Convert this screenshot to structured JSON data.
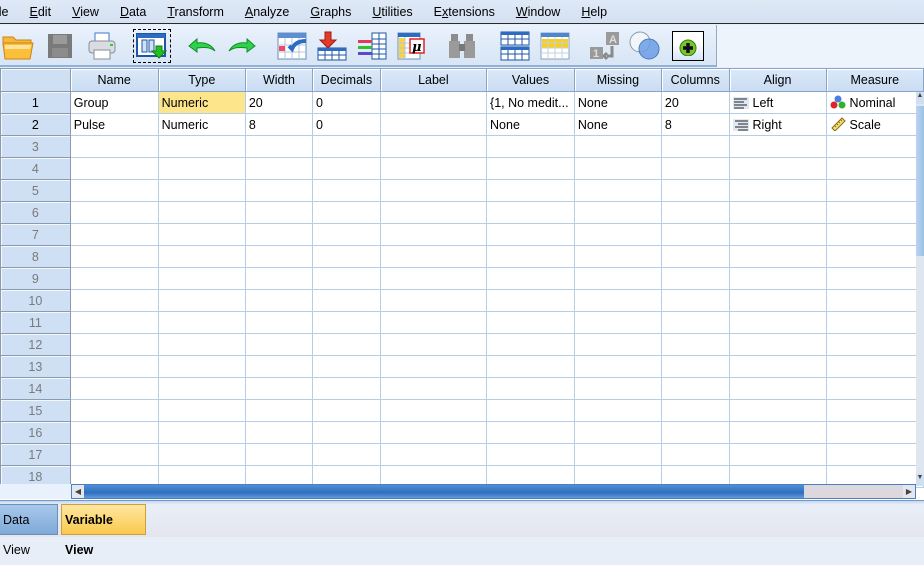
{
  "menubar": {
    "items": [
      {
        "label": "ile",
        "mnemonic": ""
      },
      {
        "label": "Edit",
        "mnemonic": "E"
      },
      {
        "label": "View",
        "mnemonic": "V"
      },
      {
        "label": "Data",
        "mnemonic": "D"
      },
      {
        "label": "Transform",
        "mnemonic": "T"
      },
      {
        "label": "Analyze",
        "mnemonic": "A"
      },
      {
        "label": "Graphs",
        "mnemonic": "G"
      },
      {
        "label": "Utilities",
        "mnemonic": "U"
      },
      {
        "label": "Extensions",
        "mnemonic": "x"
      },
      {
        "label": "Window",
        "mnemonic": "W"
      },
      {
        "label": "Help",
        "mnemonic": "H"
      }
    ]
  },
  "toolbar": {
    "buttons": [
      {
        "name": "open-folder-icon"
      },
      {
        "name": "save-icon",
        "disabled": true
      },
      {
        "name": "print-icon"
      },
      {
        "name": "recall-dialog-icon",
        "focused": true
      },
      {
        "name": "undo-icon"
      },
      {
        "name": "redo-icon"
      },
      {
        "name": "goto-case-icon"
      },
      {
        "name": "goto-variable-icon"
      },
      {
        "name": "variables-icon"
      },
      {
        "name": "descriptive-statistics-icon"
      },
      {
        "name": "find-icon",
        "disabled": true
      },
      {
        "name": "split-file-icon"
      },
      {
        "name": "select-cases-icon"
      },
      {
        "name": "value-labels-icon",
        "disabled": true
      },
      {
        "name": "use-variable-sets-icon"
      },
      {
        "name": "extension-add-icon"
      }
    ]
  },
  "grid": {
    "columns": [
      "Name",
      "Type",
      "Width",
      "Decimals",
      "Label",
      "Values",
      "Missing",
      "Columns",
      "Align",
      "Measure"
    ],
    "rows": [
      {
        "num": "1",
        "name": "Group",
        "type": "Numeric",
        "width": "20",
        "decimals": "0",
        "label": "",
        "values": "{1, No medit...",
        "missing": "None",
        "columns": "20",
        "align": "Left",
        "align_icon": "align-left-icon",
        "measure": "Nominal",
        "measure_icon": "nominal-icon"
      },
      {
        "num": "2",
        "name": "Pulse",
        "type": "Numeric",
        "width": "8",
        "decimals": "0",
        "label": "",
        "values": "None",
        "missing": "None",
        "columns": "8",
        "align": "Right",
        "align_icon": "align-right-icon",
        "measure": "Scale",
        "measure_icon": "scale-ruler-icon"
      }
    ],
    "empty_row_numbers": [
      "3",
      "4",
      "5",
      "6",
      "7",
      "8",
      "9",
      "10",
      "11",
      "12",
      "13",
      "14",
      "15",
      "16",
      "17",
      "18"
    ],
    "selected_cell": {
      "row": 1,
      "column": "Type"
    }
  },
  "tabs": [
    {
      "label": "Data View",
      "active": false
    },
    {
      "label": "Variable View",
      "active": true
    }
  ],
  "colors": {
    "selected_cell": "#fde58c",
    "active_tab": "#f9c94e",
    "header_bg": "#c9dcf3",
    "scroll_thumb": "#2f6fbe"
  }
}
